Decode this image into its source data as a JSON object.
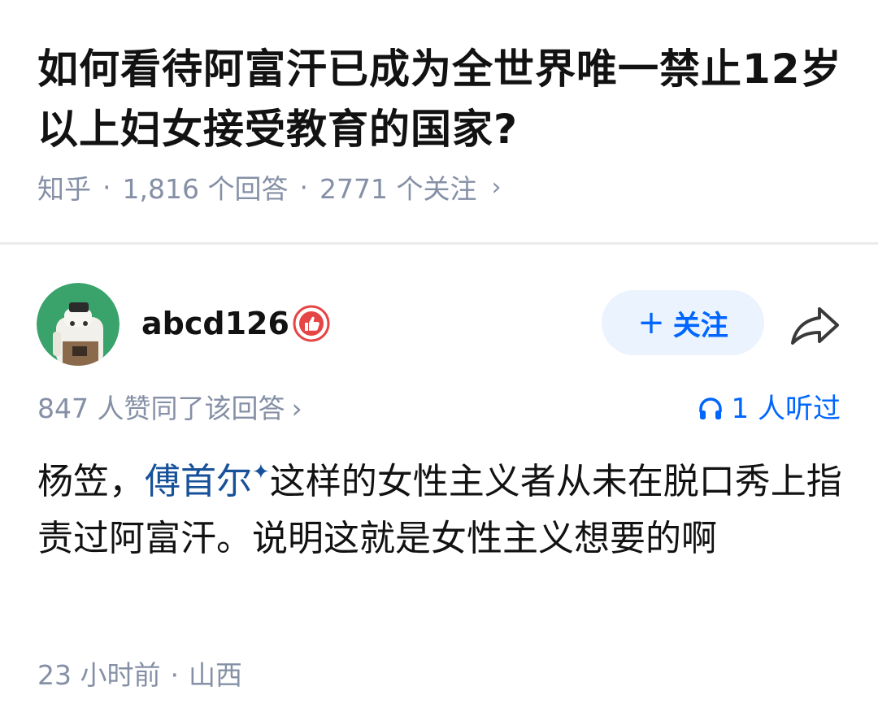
{
  "question": {
    "title": "如何看待阿富汗已成为全世界唯一禁止12岁以上妇女接受教育的国家?",
    "source": "知乎",
    "answers_count": "1,816 个回答",
    "followers_count": "2771 个关注",
    "separator": "·",
    "chevron": "›"
  },
  "author": {
    "name": "abcd126",
    "avatar_icon": "avatar-cat-icon",
    "badge_icon": "thumbs-up-badge-icon",
    "badge_color": "#e64545"
  },
  "actions": {
    "follow_plus": "+",
    "follow_label": "关注",
    "share_icon": "share-arrow-icon"
  },
  "stats": {
    "upvotes": "847 人赞同了该回答",
    "chevron": "›",
    "listen_icon": "headphones-icon",
    "listens": "1 人听过"
  },
  "answer": {
    "part1": "杨笠，",
    "link_text": "傅首尔",
    "link_mark": "✦",
    "part2": "这样的女性主义者从未在脱口秀上指责过阿富汗。说明这就是女性主义想要的啊"
  },
  "footer": {
    "time": "23 小时前",
    "separator": "·",
    "location": "山西"
  },
  "colors": {
    "accent": "#0066ff",
    "link": "#175199",
    "meta": "#8590a6",
    "follow_bg": "#eaf3fe",
    "avatar_bg": "#3aa36b"
  }
}
